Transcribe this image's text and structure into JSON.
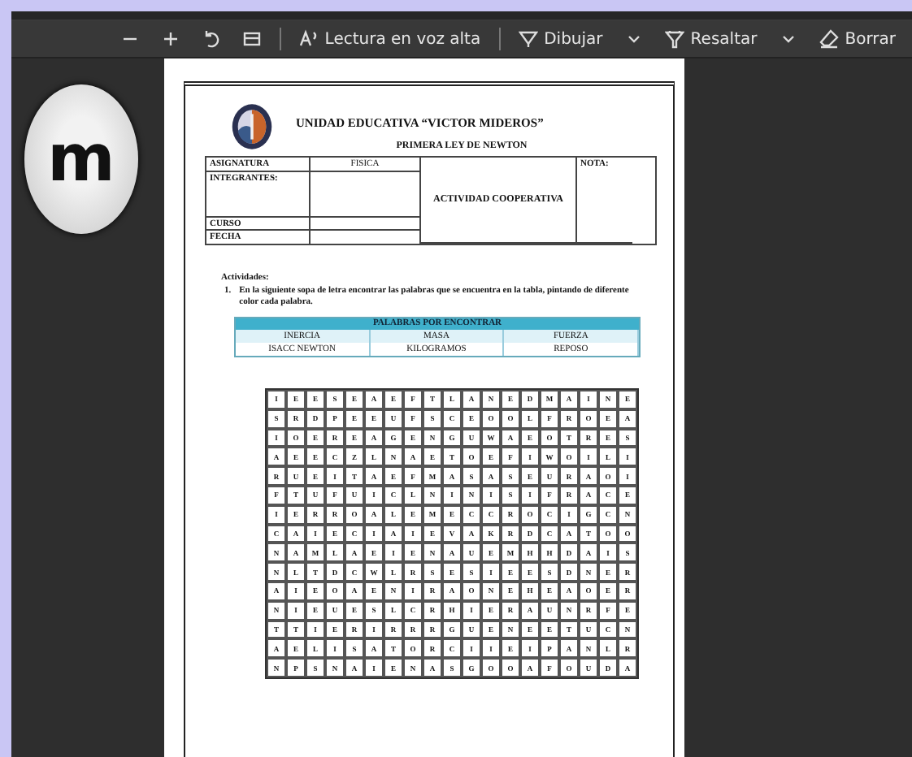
{
  "avatar": {
    "letter": "m"
  },
  "toolbar": [
    {
      "kind": "minus"
    },
    {
      "kind": "plus"
    },
    {
      "kind": "rotate"
    },
    {
      "kind": "fit"
    },
    {
      "kind": "separator"
    },
    {
      "kind": "read",
      "label": "Lectura en voz alta"
    },
    {
      "kind": "separator"
    },
    {
      "kind": "draw",
      "label": "Dibujar"
    },
    {
      "kind": "chevron"
    },
    {
      "kind": "highlight",
      "label": "Resaltar"
    },
    {
      "kind": "chevron"
    },
    {
      "kind": "erase",
      "label": "Borrar"
    }
  ],
  "document": {
    "school": "UNIDAD EDUCATIVA “VICTOR MIDEROS”",
    "title": "PRIMERA LEY DE NEWTON",
    "info": {
      "subject_label": "ASIGNATURA",
      "subject_value": "FISICA",
      "members_label": "INTEGRANTES:",
      "activity": "ACTIVIDAD COOPERATIVA",
      "grade_label": "NOTA:",
      "course_label": "CURSO",
      "date_label": "FECHA"
    },
    "activities_heading": "Actividades:",
    "instruction": {
      "number": "1.",
      "text": "En la siguiente sopa de letra encontrar las palabras que se encuentra en la tabla, pintando de diferente color cada palabra."
    },
    "words_table": {
      "header": "PALABRAS POR ENCONTRAR",
      "rows": [
        [
          "INERCIA",
          "MASA",
          "FUERZA"
        ],
        [
          "ISACC NEWTON",
          "KILOGRAMOS",
          "REPOSO"
        ]
      ]
    },
    "grid": [
      [
        "I",
        "E",
        "E",
        "S",
        "E",
        "A",
        "E",
        "F",
        "T",
        "L",
        "A",
        "N",
        "E",
        "D",
        "M",
        "A",
        "I",
        "N",
        "E"
      ],
      [
        "S",
        "R",
        "D",
        "P",
        "E",
        "E",
        "U",
        "F",
        "S",
        "C",
        "E",
        "O",
        "O",
        "L",
        "F",
        "R",
        "O",
        "E",
        "A"
      ],
      [
        "I",
        "O",
        "E",
        "R",
        "E",
        "A",
        "G",
        "E",
        "N",
        "G",
        "U",
        "W",
        "A",
        "E",
        "O",
        "T",
        "R",
        "E",
        "S"
      ],
      [
        "A",
        "E",
        "E",
        "C",
        "Z",
        "L",
        "N",
        "A",
        "E",
        "T",
        "O",
        "E",
        "F",
        "I",
        "W",
        "O",
        "I",
        "L",
        "I"
      ],
      [
        "R",
        "U",
        "E",
        "I",
        "T",
        "A",
        "E",
        "F",
        "M",
        "A",
        "S",
        "A",
        "S",
        "E",
        "U",
        "R",
        "A",
        "O",
        "I"
      ],
      [
        "F",
        "T",
        "U",
        "F",
        "U",
        "I",
        "C",
        "L",
        "N",
        "I",
        "N",
        "I",
        "S",
        "I",
        "F",
        "R",
        "A",
        "C",
        "E"
      ],
      [
        "I",
        "E",
        "R",
        "R",
        "O",
        "A",
        "L",
        "E",
        "M",
        "E",
        "C",
        "C",
        "R",
        "O",
        "C",
        "I",
        "G",
        "C",
        "N"
      ],
      [
        "C",
        "A",
        "I",
        "E",
        "C",
        "I",
        "A",
        "I",
        "E",
        "V",
        "A",
        "K",
        "R",
        "D",
        "C",
        "A",
        "T",
        "O",
        "O"
      ],
      [
        "N",
        "A",
        "M",
        "L",
        "A",
        "E",
        "I",
        "E",
        "N",
        "A",
        "U",
        "E",
        "M",
        "H",
        "H",
        "D",
        "A",
        "I",
        "S"
      ],
      [
        "N",
        "L",
        "T",
        "D",
        "C",
        "W",
        "L",
        "R",
        "S",
        "E",
        "S",
        "I",
        "E",
        "E",
        "S",
        "D",
        "N",
        "E",
        "R"
      ],
      [
        "A",
        "I",
        "E",
        "O",
        "A",
        "E",
        "N",
        "I",
        "R",
        "A",
        "O",
        "N",
        "E",
        "H",
        "E",
        "A",
        "O",
        "E",
        "R"
      ],
      [
        "N",
        "I",
        "E",
        "U",
        "E",
        "S",
        "L",
        "C",
        "R",
        "H",
        "I",
        "E",
        "R",
        "A",
        "U",
        "N",
        "R",
        "F",
        "E"
      ],
      [
        "T",
        "T",
        "I",
        "E",
        "R",
        "I",
        "R",
        "R",
        "R",
        "G",
        "U",
        "E",
        "N",
        "E",
        "E",
        "T",
        "U",
        "C",
        "N"
      ],
      [
        "A",
        "E",
        "L",
        "I",
        "S",
        "A",
        "T",
        "O",
        "R",
        "C",
        "I",
        "I",
        "E",
        "I",
        "P",
        "A",
        "N",
        "L",
        "R"
      ],
      [
        "N",
        "P",
        "S",
        "N",
        "A",
        "I",
        "E",
        "N",
        "A",
        "S",
        "G",
        "O",
        "O",
        "A",
        "F",
        "O",
        "U",
        "D",
        "A"
      ]
    ]
  }
}
